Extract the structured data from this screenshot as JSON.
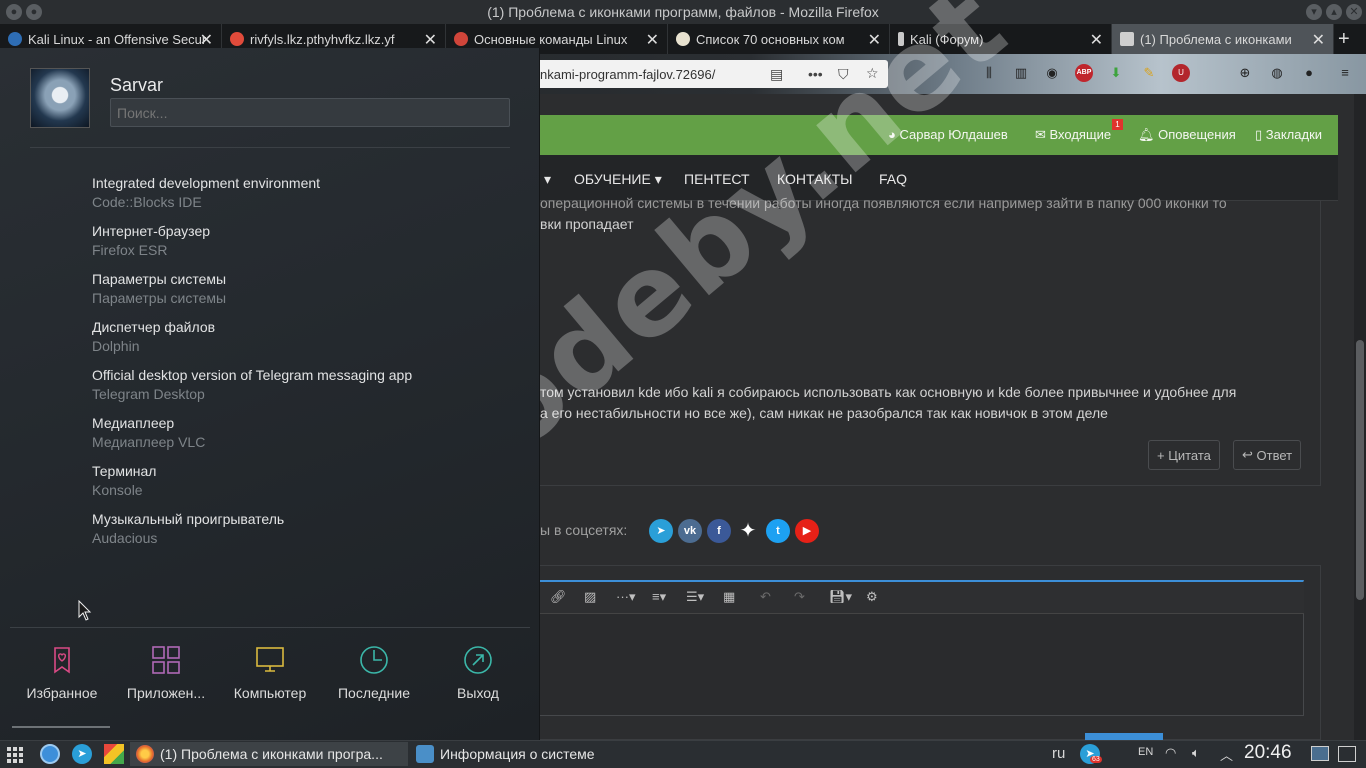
{
  "window": {
    "title": "(1) Проблема с иконками программ, файлов - Mozilla Firefox"
  },
  "tabs": [
    {
      "label": "Kali Linux - an Offensive Secur",
      "active": false
    },
    {
      "label": "rivfyls.lkz.pthyhvfkz.lkz.yf",
      "active": false
    },
    {
      "label": "Основные команды Linux",
      "active": false
    },
    {
      "label": "Список 70 основных ком",
      "active": false
    },
    {
      "label": "Kali (Форум)",
      "active": false
    },
    {
      "label": "(1) Проблема с иконками",
      "active": true
    }
  ],
  "urlbar": {
    "url": "nkami-programm-fajlov.72696/"
  },
  "site": {
    "top_links": {
      "user": "Сарвар Юлдашев",
      "inbox": "Входящие",
      "inbox_badge": "1",
      "alerts": "Оповещения",
      "bookmarks": "Закладки"
    },
    "menu": [
      "ОБУЧЕНИЕ",
      "ПЕНТЕСТ",
      "КОНТАКТЫ",
      "FAQ"
    ],
    "post": {
      "line1": "операционной системы в течении работы иногда появляются если например зайти в папку 000 иконки то",
      "line2": "вки пропадает",
      "line3": "том установил kde ибо kali я собираюсь использовать как основную и kde более привычнее и удобнее для",
      "line4": "а его нестабильности но все же), сам никак не разобрался так как новичок в этом деле",
      "quote_btn": "+ Цитата",
      "reply_btn": "Ответ"
    },
    "share_text": "ы в соцсетях:",
    "watermark": "codeby.net"
  },
  "launcher": {
    "user": "Sarvar",
    "search_placeholder": "Поиск...",
    "favorites": [
      {
        "title": "Integrated development environment",
        "subtitle": "Code::Blocks IDE"
      },
      {
        "title": "Интернет-браузер",
        "subtitle": "Firefox ESR"
      },
      {
        "title": "Параметры системы",
        "subtitle": "Параметры системы"
      },
      {
        "title": "Диспетчер файлов",
        "subtitle": "Dolphin"
      },
      {
        "title": "Official desktop version of Telegram messaging app",
        "subtitle": "Telegram Desktop"
      },
      {
        "title": "Медиаплеер",
        "subtitle": "Медиаплеер VLC"
      },
      {
        "title": "Терминал",
        "subtitle": "Konsole"
      },
      {
        "title": "Музыкальный проигрыватель",
        "subtitle": "Audacious"
      }
    ],
    "tabs": [
      "Избранное",
      "Приложен...",
      "Компьютер",
      "Последние",
      "Выход"
    ]
  },
  "taskbar": {
    "tasks": [
      {
        "label": "(1) Проблема с иконками програ..."
      },
      {
        "label": "Информация о системе"
      }
    ],
    "lang": "ru",
    "kb_layout": "EN",
    "telegram_badge": "63",
    "clock": "20:46"
  },
  "colors": {
    "site_green": "#63a046",
    "accent_blue": "#3c8fd8"
  }
}
